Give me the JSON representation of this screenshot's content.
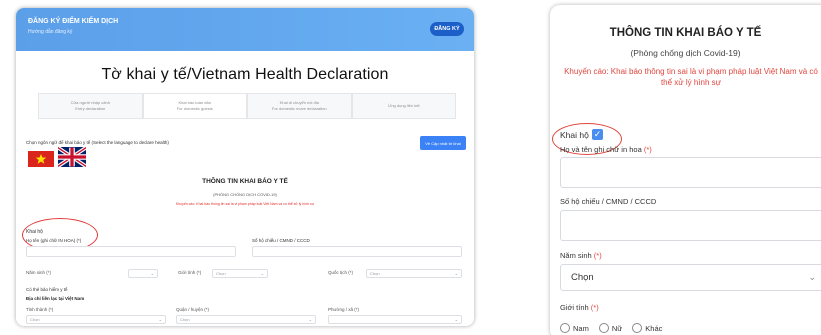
{
  "left": {
    "header": {
      "title": "ĐĂNG KÝ ĐIỂM KIỂM DỊCH",
      "subtitle": "Hướng dẫn đăng ký",
      "register_label": "ĐĂNG KÝ"
    },
    "form_title": "Tờ khai y tế/Vietnam Health Declaration",
    "tabs": [
      {
        "line1": "Cửa người nhập cảnh",
        "line2": "Entry declaration"
      },
      {
        "line1": "Khai báo toàn dân",
        "line2": "For domestic guests"
      },
      {
        "line1": "Khai di chuyển nội địa",
        "line2": "For domestic move declaration"
      },
      {
        "line1": "Ứng dụng liên kết",
        "line2": ""
      }
    ],
    "language_prompt": "Chọn ngôn ngữ để khai báo y tế (Select the language to declare health)",
    "update_button": "Về Cập nhật tờ khai",
    "info_title": "THÔNG TIN KHAI BÁO Y TẾ",
    "info_subtitle": "(PHÒNG CHỐNG DỊCH COVID-19)",
    "info_warning": "Khuyến cáo: Khai báo thông tin sai là vi phạm pháp luật Việt Nam và có thể xử lý hình sự",
    "proxy_label": "Khai hộ",
    "name_label": "Họ tên (ghi chữ IN HOA) (*)",
    "id_label": "Số hộ chiếu / CMND / CCCD",
    "birth_year_label": "Năm sinh (*)",
    "gender_label": "Giới tính (*)",
    "gender_value": "Chọn",
    "nationality_label": "Quốc tịch (*)",
    "nationality_value": "Chọn",
    "insurance_label": "Có thẻ bảo hiểm y tế",
    "address_section": "Địa chỉ liên lạc tại Việt Nam",
    "province_label": "Tỉnh thành (*)",
    "district_label": "Quận / huyện (*)",
    "ward_label": "Phường / xã (*)",
    "select_placeholder": "Chọn"
  },
  "right": {
    "title": "THÔNG TIN KHAI BÁO Y TẾ",
    "subtitle": "(Phòng chống dịch Covid-19)",
    "warning": "Khuyến cáo: Khai báo thông tin sai là vi phạm pháp luật Việt Nam và có thể xử lý hình sự",
    "proxy_label": "Khai hộ",
    "name_label": "Họ và tên ghi chữ in hoa",
    "id_label": "Số hộ chiếu / CMND / CCCD",
    "birth_label": "Năm sinh",
    "birth_value": "Chọn",
    "gender_label": "Giới tính",
    "required_mark": "(*)",
    "gender_options": [
      "Nam",
      "Nữ",
      "Khác"
    ]
  }
}
